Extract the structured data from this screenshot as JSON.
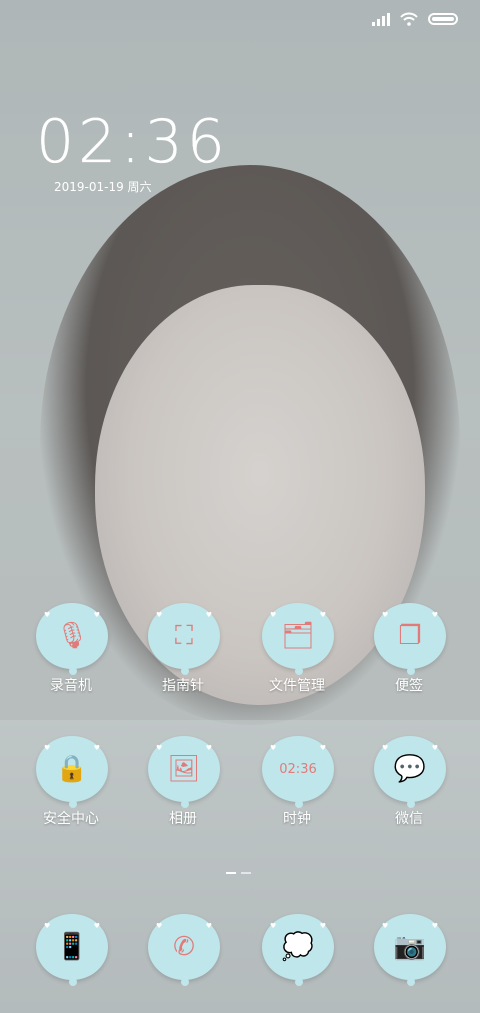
{
  "status": {
    "signal": "signal-bars-icon",
    "wifi": "wifi-icon",
    "battery": "battery-icon"
  },
  "clock": {
    "time": "02:36",
    "date": "2019-01-19 周六"
  },
  "apps_row1": [
    {
      "label": "录音机",
      "icon": "microphone-icon",
      "glyph": "🎙"
    },
    {
      "label": "指南针",
      "icon": "compass-icon",
      "glyph": "⛶"
    },
    {
      "label": "文件管理",
      "icon": "folder-tray-icon",
      "glyph": "🗂"
    },
    {
      "label": "便签",
      "icon": "notes-icon",
      "glyph": "❐"
    }
  ],
  "apps_row2": [
    {
      "label": "安全中心",
      "icon": "lock-icon",
      "glyph": "🔒"
    },
    {
      "label": "相册",
      "icon": "photo-icon",
      "glyph": "🖼"
    },
    {
      "label": "时钟",
      "icon": "clock-icon",
      "glyph_text": "02:36"
    },
    {
      "label": "微信",
      "icon": "wechat-icon",
      "glyph": "💬"
    }
  ],
  "dock": [
    {
      "icon": "phone-device-icon",
      "glyph": "📱"
    },
    {
      "icon": "call-icon",
      "glyph": "✆"
    },
    {
      "icon": "message-icon",
      "glyph": "💭"
    },
    {
      "icon": "camera-icon",
      "glyph": "📷"
    }
  ],
  "colors": {
    "bubble": "#bfe6ea",
    "glyph": "#e27a7a",
    "text": "#ffffff"
  }
}
